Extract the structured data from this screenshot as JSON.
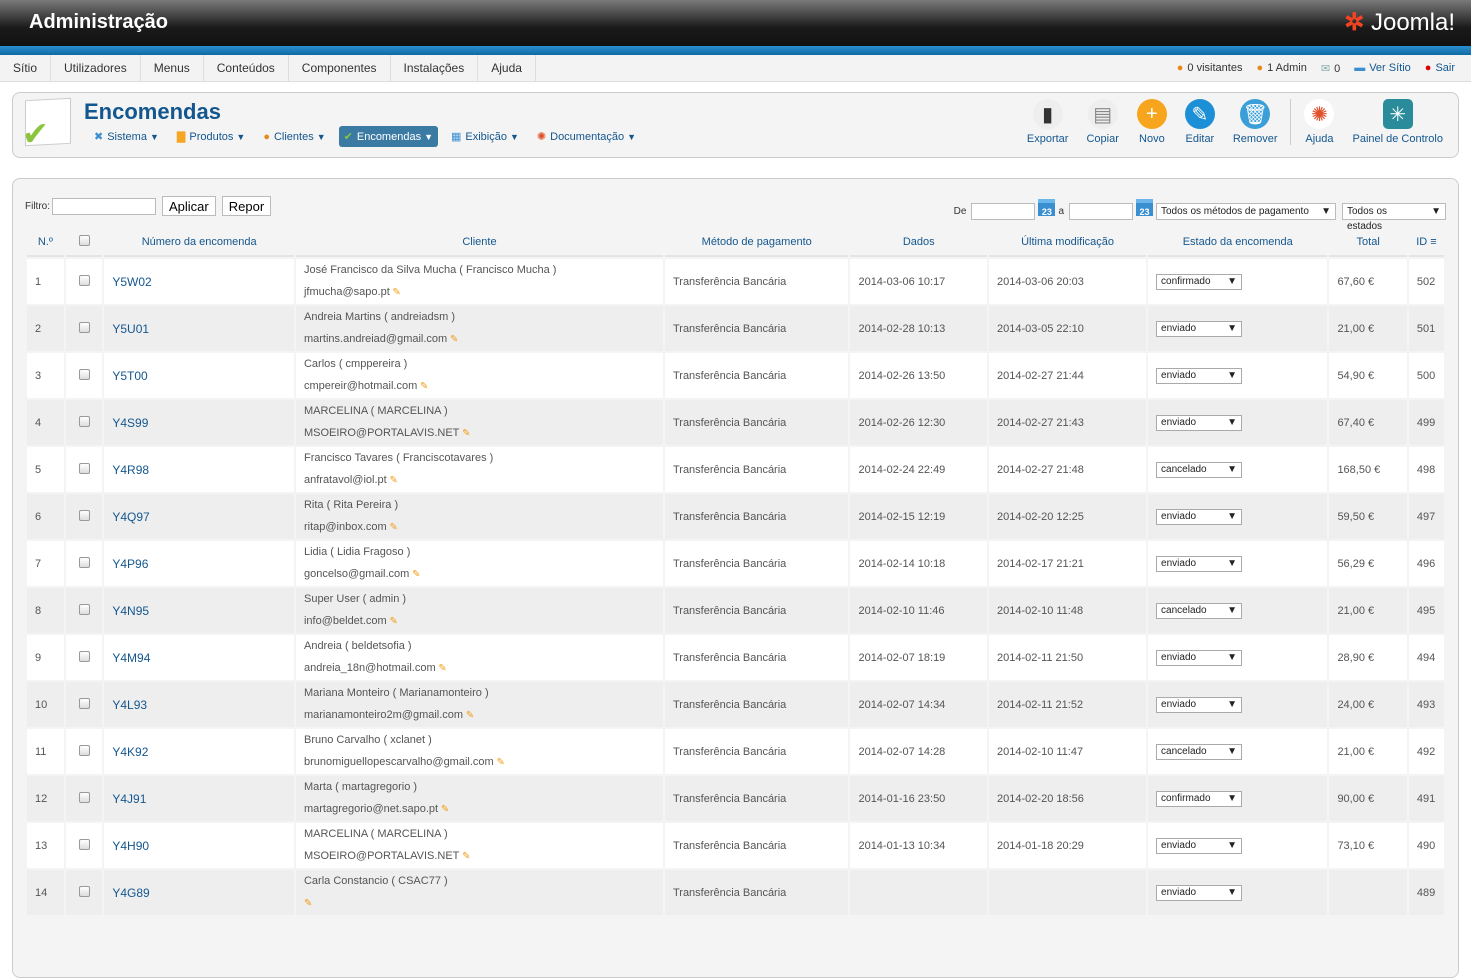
{
  "header": {
    "title": "Administração",
    "logo": "Joomla!"
  },
  "menu": [
    "Sítio",
    "Utilizadores",
    "Menus",
    "Conteúdos",
    "Componentes",
    "Instalações",
    "Ajuda"
  ],
  "status": {
    "visitors": "0 visitantes",
    "admin": "1 Admin",
    "messages": "0",
    "view_site": "Ver Sítio",
    "logout": "Sair"
  },
  "toolbar": {
    "title": "Encomendas",
    "submenu": [
      "Sistema",
      "Produtos",
      "Clientes",
      "Encomendas",
      "Exibição",
      "Documentação"
    ],
    "actions": [
      "Exportar",
      "Copiar",
      "Novo",
      "Editar",
      "Remover"
    ],
    "help": "Ajuda",
    "control_panel": "Painel de Controlo"
  },
  "filters": {
    "label": "Filtro:",
    "apply": "Aplicar",
    "reset": "Repor",
    "from": "De",
    "to": "a",
    "calendar": "23",
    "payment": "Todos os métodos de pagamento",
    "state": "Todos os estados"
  },
  "columns": [
    "N.º",
    "",
    "Número da encomenda",
    "Cliente",
    "Método de pagamento",
    "Dados",
    "Última modificação",
    "Estado da encomenda",
    "Total",
    "ID"
  ],
  "rows": [
    {
      "n": "1",
      "num": "Y5W02",
      "name": "José Francisco da Silva Mucha ( Francisco Mucha )",
      "email": "jfmucha@sapo.pt",
      "pay": "Transferência Bancária",
      "date": "2014-03-06 10:17",
      "mod": "2014-03-06 20:03",
      "state": "confirmado",
      "total": "67,60 €",
      "id": "502"
    },
    {
      "n": "2",
      "num": "Y5U01",
      "name": "Andreia Martins ( andreiadsm )",
      "email": "martins.andreiad@gmail.com",
      "pay": "Transferência Bancária",
      "date": "2014-02-28 10:13",
      "mod": "2014-03-05 22:10",
      "state": "enviado",
      "total": "21,00 €",
      "id": "501"
    },
    {
      "n": "3",
      "num": "Y5T00",
      "name": "Carlos ( cmppereira )",
      "email": "cmpereir@hotmail.com",
      "pay": "Transferência Bancária",
      "date": "2014-02-26 13:50",
      "mod": "2014-02-27 21:44",
      "state": "enviado",
      "total": "54,90 €",
      "id": "500"
    },
    {
      "n": "4",
      "num": "Y4S99",
      "name": "MARCELINA ( MARCELINA )",
      "email": "MSOEIRO@PORTALAVIS.NET",
      "pay": "Transferência Bancária",
      "date": "2014-02-26 12:30",
      "mod": "2014-02-27 21:43",
      "state": "enviado",
      "total": "67,40 €",
      "id": "499"
    },
    {
      "n": "5",
      "num": "Y4R98",
      "name": "Francisco Tavares ( Franciscotavares )",
      "email": "anfratavol@iol.pt",
      "pay": "Transferência Bancária",
      "date": "2014-02-24 22:49",
      "mod": "2014-02-27 21:48",
      "state": "cancelado",
      "total": "168,50 €",
      "id": "498"
    },
    {
      "n": "6",
      "num": "Y4Q97",
      "name": "Rita ( Rita Pereira )",
      "email": "ritap@inbox.com",
      "pay": "Transferência Bancária",
      "date": "2014-02-15 12:19",
      "mod": "2014-02-20 12:25",
      "state": "enviado",
      "total": "59,50 €",
      "id": "497"
    },
    {
      "n": "7",
      "num": "Y4P96",
      "name": "Lidia ( Lidia Fragoso )",
      "email": "goncelso@gmail.com",
      "pay": "Transferência Bancária",
      "date": "2014-02-14 10:18",
      "mod": "2014-02-17 21:21",
      "state": "enviado",
      "total": "56,29 €",
      "id": "496"
    },
    {
      "n": "8",
      "num": "Y4N95",
      "name": "Super User ( admin )",
      "email": "info@beldet.com",
      "pay": "Transferência Bancária",
      "date": "2014-02-10 11:46",
      "mod": "2014-02-10 11:48",
      "state": "cancelado",
      "total": "21,00 €",
      "id": "495"
    },
    {
      "n": "9",
      "num": "Y4M94",
      "name": "Andreia ( beldetsofia )",
      "email": "andreia_18n@hotmail.com",
      "pay": "Transferência Bancária",
      "date": "2014-02-07 18:19",
      "mod": "2014-02-11 21:50",
      "state": "enviado",
      "total": "28,90 €",
      "id": "494"
    },
    {
      "n": "10",
      "num": "Y4L93",
      "name": "Mariana Monteiro ( Marianamonteiro )",
      "email": "marianamonteiro2m@gmail.com",
      "pay": "Transferência Bancária",
      "date": "2014-02-07 14:34",
      "mod": "2014-02-11 21:52",
      "state": "enviado",
      "total": "24,00 €",
      "id": "493"
    },
    {
      "n": "11",
      "num": "Y4K92",
      "name": "Bruno Carvalho ( xclanet )",
      "email": "brunomiguellopescarvalho@gmail.com",
      "pay": "Transferência Bancária",
      "date": "2014-02-07 14:28",
      "mod": "2014-02-10 11:47",
      "state": "cancelado",
      "total": "21,00 €",
      "id": "492"
    },
    {
      "n": "12",
      "num": "Y4J91",
      "name": "Marta ( martagregorio )",
      "email": "martagregorio@net.sapo.pt",
      "pay": "Transferência Bancária",
      "date": "2014-01-16 23:50",
      "mod": "2014-02-20 18:56",
      "state": "confirmado",
      "total": "90,00 €",
      "id": "491"
    },
    {
      "n": "13",
      "num": "Y4H90",
      "name": "MARCELINA ( MARCELINA )",
      "email": "MSOEIRO@PORTALAVIS.NET",
      "pay": "Transferência Bancária",
      "date": "2014-01-13 10:34",
      "mod": "2014-01-18 20:29",
      "state": "enviado",
      "total": "73,10 €",
      "id": "490"
    },
    {
      "n": "14",
      "num": "Y4G89",
      "name": "Carla Constancio ( CSAC77 )",
      "email": "",
      "pay": "Transferência Bancária",
      "date": "",
      "mod": "",
      "state": "enviado",
      "total": "",
      "id": "489"
    }
  ]
}
